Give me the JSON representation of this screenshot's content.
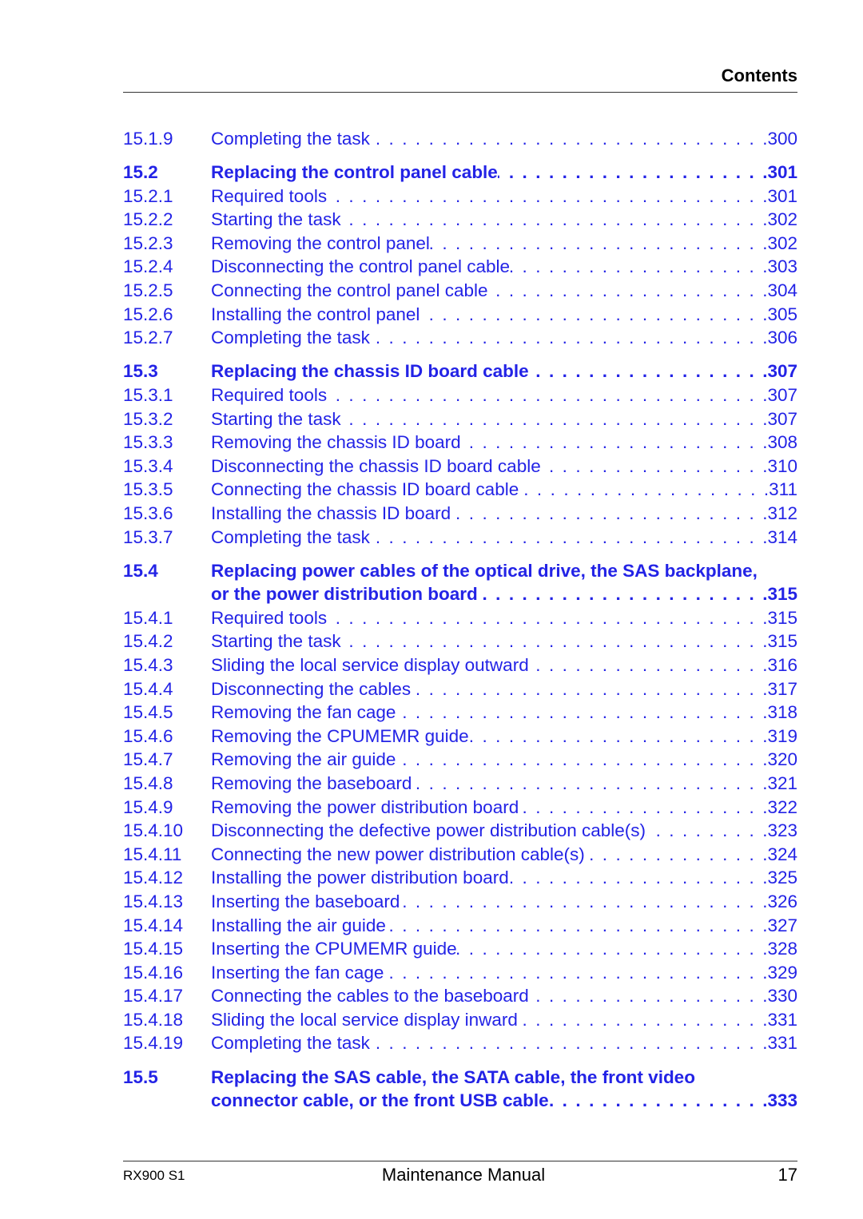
{
  "header": {
    "title": "Contents"
  },
  "toc": [
    {
      "num": "15.1.9",
      "title": "Completing the task",
      "page": "300",
      "level": "sub"
    },
    {
      "num": "15.2",
      "title": "Replacing the control panel cable",
      "page": "301",
      "level": "sec"
    },
    {
      "num": "15.2.1",
      "title": "Required tools",
      "page": "301",
      "level": "sub"
    },
    {
      "num": "15.2.2",
      "title": "Starting the task",
      "page": "302",
      "level": "sub"
    },
    {
      "num": "15.2.3",
      "title": "Removing the control panel",
      "page": "302",
      "level": "sub"
    },
    {
      "num": "15.2.4",
      "title": "Disconnecting the control panel cable",
      "page": "303",
      "level": "sub"
    },
    {
      "num": "15.2.5",
      "title": "Connecting the control panel cable",
      "page": "304",
      "level": "sub"
    },
    {
      "num": "15.2.6",
      "title": "Installing the control panel",
      "page": "305",
      "level": "sub"
    },
    {
      "num": "15.2.7",
      "title": "Completing the task",
      "page": "306",
      "level": "sub"
    },
    {
      "num": "15.3",
      "title": "Replacing the chassis ID board cable",
      "page": "307",
      "level": "sec"
    },
    {
      "num": "15.3.1",
      "title": "Required tools",
      "page": "307",
      "level": "sub"
    },
    {
      "num": "15.3.2",
      "title": "Starting the task",
      "page": "307",
      "level": "sub"
    },
    {
      "num": "15.3.3",
      "title": "Removing the chassis ID board",
      "page": "308",
      "level": "sub"
    },
    {
      "num": "15.3.4",
      "title": "Disconnecting the chassis ID board cable",
      "page": "310",
      "level": "sub"
    },
    {
      "num": "15.3.5",
      "title": "Connecting the chassis ID board cable",
      "page": "311",
      "level": "sub"
    },
    {
      "num": "15.3.6",
      "title": "Installing the chassis ID board",
      "page": "312",
      "level": "sub"
    },
    {
      "num": "15.3.7",
      "title": "Completing the task",
      "page": "314",
      "level": "sub"
    },
    {
      "num": "15.4",
      "title": "Replacing power cables of the optical drive, the SAS backplane,",
      "title2": "or the power distribution board",
      "page": "315",
      "level": "sec"
    },
    {
      "num": "15.4.1",
      "title": "Required tools",
      "page": "315",
      "level": "sub"
    },
    {
      "num": "15.4.2",
      "title": "Starting the task",
      "page": "315",
      "level": "sub"
    },
    {
      "num": "15.4.3",
      "title": "Sliding the local service display outward",
      "page": "316",
      "level": "sub"
    },
    {
      "num": "15.4.4",
      "title": "Disconnecting the cables",
      "page": "317",
      "level": "sub"
    },
    {
      "num": "15.4.5",
      "title": "Removing the fan cage",
      "page": "318",
      "level": "sub"
    },
    {
      "num": "15.4.6",
      "title": "Removing the CPUMEMR guide",
      "page": "319",
      "level": "sub"
    },
    {
      "num": "15.4.7",
      "title": "Removing the air guide",
      "page": "320",
      "level": "sub"
    },
    {
      "num": "15.4.8",
      "title": "Removing the baseboard",
      "page": "321",
      "level": "sub"
    },
    {
      "num": "15.4.9",
      "title": "Removing the power distribution board",
      "page": "322",
      "level": "sub"
    },
    {
      "num": "15.4.10",
      "title": "Disconnecting the defective power distribution cable(s)",
      "page": "323",
      "level": "sub"
    },
    {
      "num": "15.4.11",
      "title": "Connecting the new power distribution cable(s)",
      "page": "324",
      "level": "sub"
    },
    {
      "num": "15.4.12",
      "title": "Installing the power distribution board",
      "page": "325",
      "level": "sub"
    },
    {
      "num": "15.4.13",
      "title": "Inserting the baseboard",
      "page": "326",
      "level": "sub"
    },
    {
      "num": "15.4.14",
      "title": "Installing the air guide",
      "page": "327",
      "level": "sub"
    },
    {
      "num": "15.4.15",
      "title": "Inserting the CPUMEMR guide",
      "page": "328",
      "level": "sub"
    },
    {
      "num": "15.4.16",
      "title": "Inserting the fan cage",
      "page": "329",
      "level": "sub"
    },
    {
      "num": "15.4.17",
      "title": "Connecting the cables to the baseboard",
      "page": "330",
      "level": "sub"
    },
    {
      "num": "15.4.18",
      "title": "Sliding the local service display inward",
      "page": "331",
      "level": "sub"
    },
    {
      "num": "15.4.19",
      "title": "Completing the task",
      "page": "331",
      "level": "sub"
    },
    {
      "num": "15.5",
      "title": "Replacing the SAS cable, the SATA cable, the front video",
      "title2": "connector cable, or the front USB cable",
      "page": "333",
      "level": "sec"
    }
  ],
  "footer": {
    "left": "RX900 S1",
    "center": "Maintenance Manual",
    "page_number": "17"
  },
  "colors": {
    "link": "#2323e6",
    "text": "#000000"
  }
}
